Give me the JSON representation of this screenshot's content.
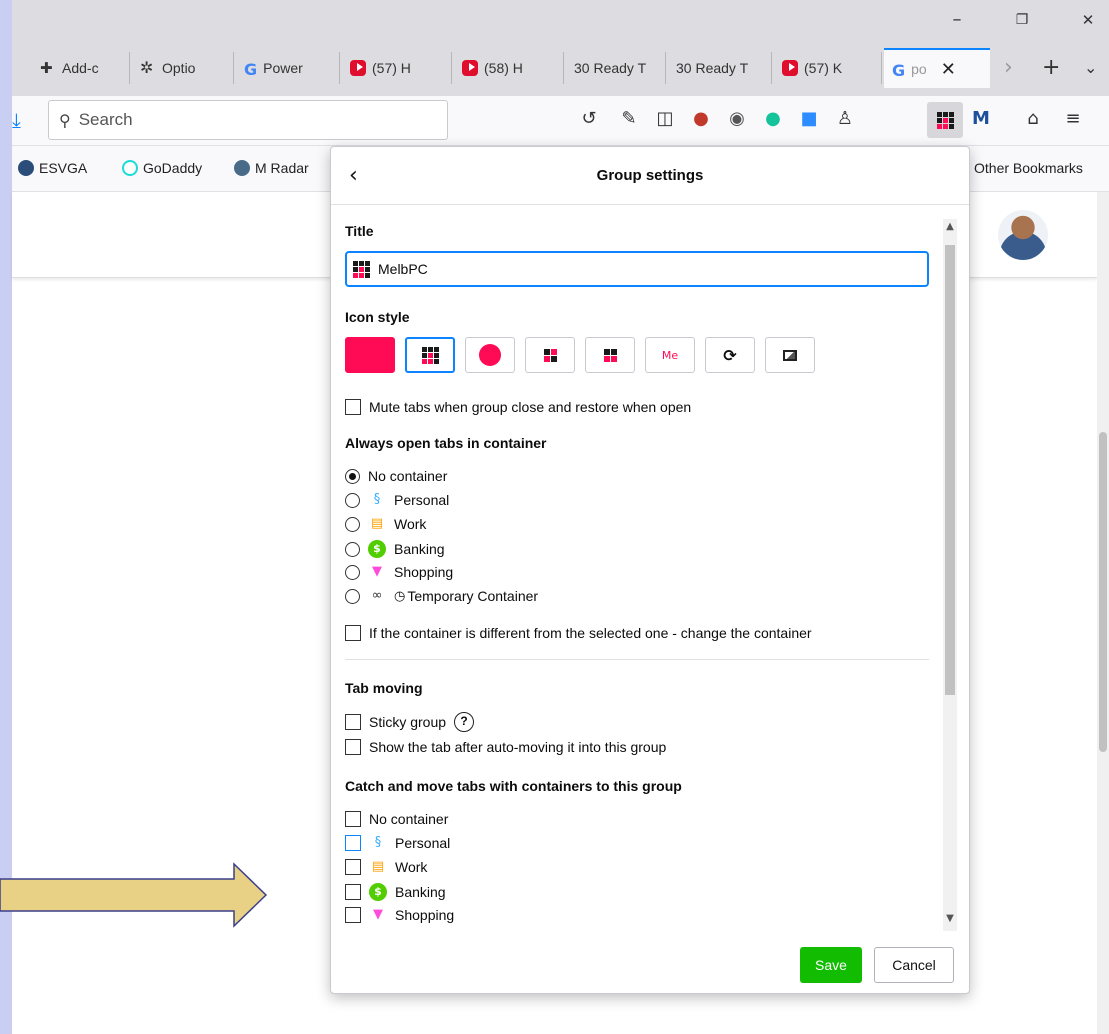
{
  "window": {
    "minimize": "–",
    "restore": "❐",
    "close": "✕"
  },
  "tabs": [
    {
      "label": "Add-c",
      "icon": "puzzle-icon"
    },
    {
      "label": "Optio",
      "icon": "gear-icon"
    },
    {
      "label": "Power",
      "icon": "google-icon"
    },
    {
      "label": "(57) H",
      "icon": "youtube-icon"
    },
    {
      "label": "(58) H",
      "icon": "youtube-icon"
    },
    {
      "label": "30 Ready T",
      "icon": "none"
    },
    {
      "label": "30 Ready T",
      "icon": "none"
    },
    {
      "label": "(57) K",
      "icon": "youtube-icon"
    },
    {
      "label": "po",
      "icon": "google-icon",
      "active": true
    }
  ],
  "toolbar": {
    "search_placeholder": "Search",
    "icons": [
      "history-icon",
      "eyedropper-icon",
      "reader-icon",
      "extension-icon",
      "extension-icon",
      "grammarly-icon",
      "zoom-icon",
      "people-icon",
      "simple-tab-groups-icon",
      "notification-icon",
      "gift-icon",
      "menu-icon"
    ]
  },
  "bookmarks": {
    "items": [
      {
        "label": "ESVGA",
        "color": "#2a4d7a"
      },
      {
        "label": "GoDaddy",
        "color": "#1bdbdb"
      },
      {
        "label": "M Radar",
        "color": "#4a6a8a"
      }
    ],
    "other": "Other Bookmarks"
  },
  "panel": {
    "title": "Group settings",
    "back_icon": "‹",
    "title_section": "Title",
    "title_value": "MelbPC",
    "icon_style_label": "Icon style",
    "icon_styles": [
      "color",
      "title-icon",
      "circle",
      "squares",
      "old-tab-groups",
      "title",
      "refresh",
      "image"
    ],
    "me_text": "Me",
    "mute_label": "Mute tabs when group close and restore when open",
    "container_label": "Always open tabs in container",
    "containers": [
      {
        "label": "No container",
        "icon": ""
      },
      {
        "label": "Personal",
        "icon": "fingerprint-icon"
      },
      {
        "label": "Work",
        "icon": "briefcase-icon"
      },
      {
        "label": "Banking",
        "icon": "dollar-icon"
      },
      {
        "label": "Shopping",
        "icon": "cart-icon"
      },
      {
        "label": "Temporary Container",
        "icon": "glasses-icon"
      }
    ],
    "change_container_label": "If the container is different from the selected one - change the container",
    "tab_moving_label": "Tab moving",
    "sticky_label": "Sticky group",
    "help_glyph": "?",
    "show_tab_label": "Show the tab after auto-moving it into this group",
    "catch_label": "Catch and move tabs with containers to this group",
    "catch_containers": [
      {
        "label": "No container",
        "icon": ""
      },
      {
        "label": "Personal",
        "icon": "fingerprint-icon"
      },
      {
        "label": "Work",
        "icon": "briefcase-icon"
      },
      {
        "label": "Banking",
        "icon": "dollar-icon"
      },
      {
        "label": "Shopping",
        "icon": "cart-icon"
      }
    ],
    "save": "Save",
    "cancel": "Cancel"
  },
  "colors": {
    "accent": "#0a84ff",
    "group_color": "#ff0a54",
    "save": "#12bc00",
    "arrow_fill": "#e8d184",
    "arrow_stroke": "#3b3f8c"
  }
}
